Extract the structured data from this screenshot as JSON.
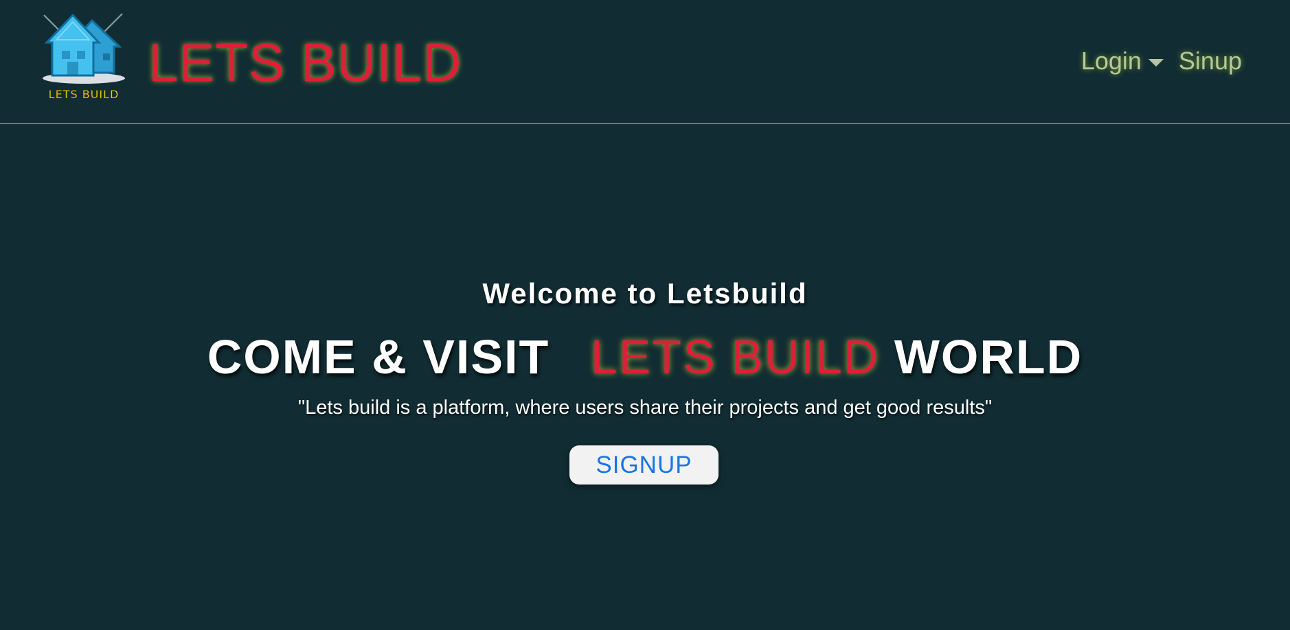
{
  "header": {
    "logo_caption": "LETS BUILD",
    "brand_title": "LETS BUILD",
    "nav": {
      "login_label": "Login",
      "signup_label": "Sinup"
    }
  },
  "hero": {
    "welcome": "Welcome to Letsbuild",
    "headline_prefix": "COME & VISIT",
    "headline_accent": "LETS BUILD",
    "headline_suffix": "WORLD",
    "tagline": "\"Lets build is a platform, where users share their projects and get good results\"",
    "cta_label": "SIGNUP"
  },
  "colors": {
    "background": "#112d33",
    "brand_red": "#dc1f3a",
    "nav_text": "#b5c994",
    "cta_text": "#1a74e8"
  },
  "icons": {
    "logo": "house-logo-icon",
    "login_dropdown": "caret-down-icon"
  }
}
